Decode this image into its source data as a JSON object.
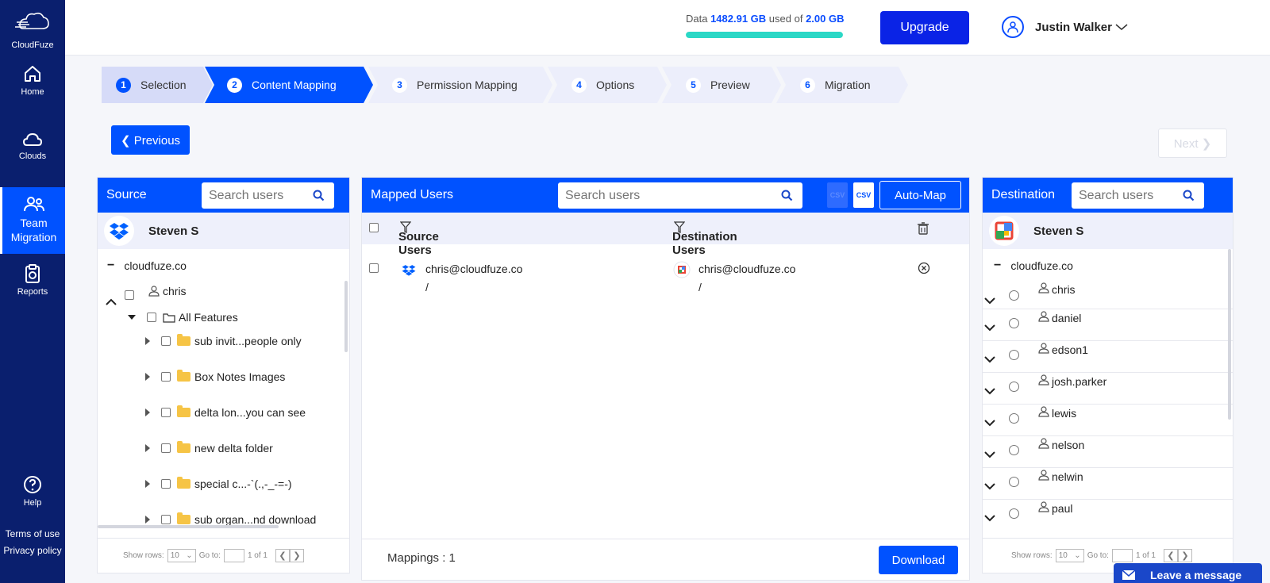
{
  "brand": {
    "name": "CloudFuze"
  },
  "sidebar": {
    "items": [
      {
        "label": "Home",
        "icon": "home-icon"
      },
      {
        "label": "Clouds",
        "icon": "cloud-icon"
      },
      {
        "label_line1": "Team",
        "label_line2": "Migration",
        "icon": "team-icon",
        "active": true
      },
      {
        "label": "Reports",
        "icon": "reports-icon"
      },
      {
        "label": "Help",
        "icon": "help-icon"
      }
    ],
    "footer": {
      "terms": "Terms of use",
      "privacy": "Privacy policy"
    }
  },
  "header": {
    "storage_prefix": "Data ",
    "storage_used": "1482.91 GB",
    "storage_middle": " used of ",
    "storage_total": "2.00 GB",
    "storage_fill_percent": 100,
    "upgrade_label": "Upgrade",
    "user_name": "Justin Walker"
  },
  "steps": [
    {
      "num": "1",
      "label": "Selection",
      "state": "done"
    },
    {
      "num": "2",
      "label": "Content Mapping",
      "state": "active"
    },
    {
      "num": "3",
      "label": "Permission Mapping",
      "state": "todo"
    },
    {
      "num": "4",
      "label": "Options",
      "state": "todo"
    },
    {
      "num": "5",
      "label": "Preview",
      "state": "todo"
    },
    {
      "num": "6",
      "label": "Migration",
      "state": "todo"
    }
  ],
  "nav_buttons": {
    "previous": "Previous",
    "next": "Next"
  },
  "source": {
    "title": "Source",
    "search_placeholder": "Search users",
    "cloud_user": "Steven S",
    "domain": "cloudfuze.co",
    "user": "chris",
    "root_folder": "All Features",
    "folders": [
      "sub invit...people only",
      "Box Notes Images",
      "delta lon...you can see",
      "new delta folder",
      "special c...-`(.,-_-=-)",
      "sub organ...nd download"
    ],
    "pager": {
      "show_rows": "Show rows:",
      "rows_value": "10",
      "goto": "Go to:",
      "of": "1 of 1"
    }
  },
  "mapped": {
    "title": "Mapped Users",
    "search_placeholder": "Search users",
    "csv_label": "CSV",
    "automap_label": "Auto-Map",
    "col_source": "Source Users",
    "col_dest": "Destination Users",
    "rows": [
      {
        "source": "chris@cloudfuze.co",
        "source_path": "/",
        "dest": "chris@cloudfuze.co",
        "dest_path": "/"
      }
    ],
    "mappings_label": "Mappings : 1",
    "download_label": "Download"
  },
  "destination": {
    "title": "Destination",
    "search_placeholder": "Search users",
    "cloud_user": "Steven S",
    "domain": "cloudfuze.co",
    "users": [
      "chris",
      "daniel",
      "edson1",
      "josh.parker",
      "lewis",
      "nelson",
      "nelwin",
      "paul"
    ],
    "pager": {
      "show_rows": "Show rows:",
      "rows_value": "10",
      "goto": "Go to:",
      "of": "1 of 1"
    }
  },
  "chat": {
    "label": "Leave a message"
  },
  "colors": {
    "primary": "#0052ff",
    "sidebar": "#0a1f6e",
    "accent": "#2bd8c6"
  }
}
